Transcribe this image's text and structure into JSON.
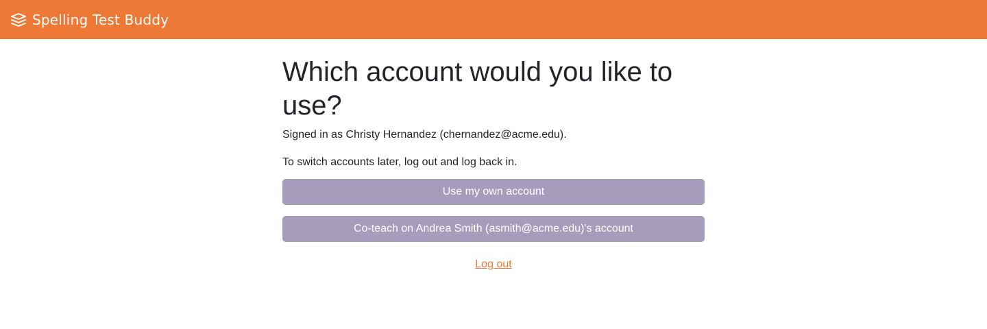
{
  "header": {
    "brand_icon": "stacked-layers-icon",
    "app_name": "Spelling Test Buddy",
    "background_color": "#ee7835"
  },
  "main": {
    "title": "Which account would you like to use?",
    "signed_in_text": "Signed in as Christy Hernandez (chernandez@acme.edu).",
    "switch_hint": "To switch accounts later, log out and log back in.",
    "buttons": [
      {
        "label": "Use my own account"
      },
      {
        "label": "Co-teach on Andrea Smith (asmith@acme.edu)'s account"
      }
    ],
    "button_color": "#a69cbc",
    "logout_label": "Log out",
    "link_color": "#ee7835"
  }
}
